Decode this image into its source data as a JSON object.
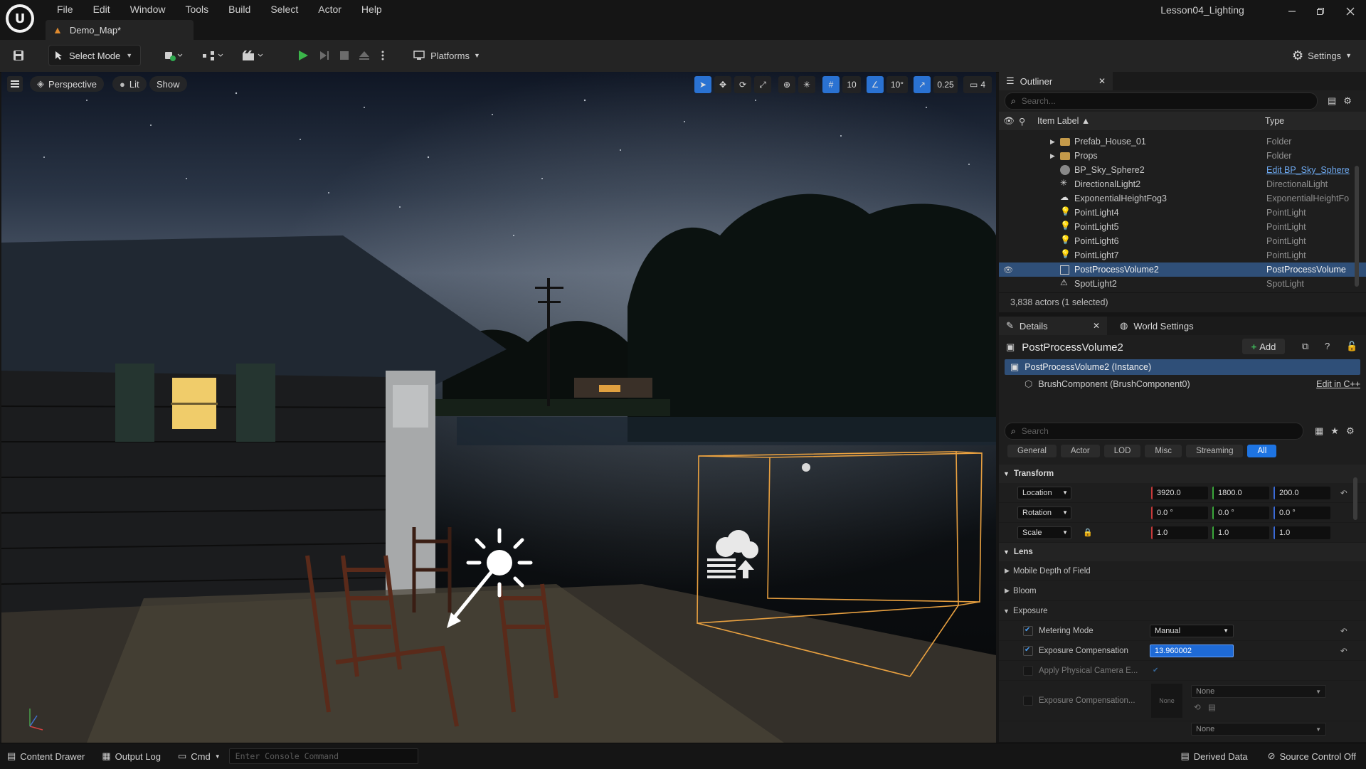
{
  "app": {
    "menu": [
      "File",
      "Edit",
      "Window",
      "Tools",
      "Build",
      "Select",
      "Actor",
      "Help"
    ],
    "map_tab": "Demo_Map*",
    "project_name": "Lesson04_Lighting"
  },
  "toolbar": {
    "select_mode": "Select Mode",
    "platforms": "Platforms",
    "settings": "Settings"
  },
  "viewport": {
    "perspective": "Perspective",
    "lit": "Lit",
    "show": "Show",
    "grid_snap": "10",
    "rotation_snap": "10°",
    "scale_snap": "0.25",
    "camera_speed": "4"
  },
  "outliner": {
    "tab": "Outliner",
    "search_placeholder": "Search...",
    "col_label": "Item Label ▲",
    "col_type": "Type",
    "rows": [
      {
        "name": "Prefab_House_01",
        "type": "Folder"
      },
      {
        "name": "Props",
        "type": "Folder"
      },
      {
        "name": "BP_Sky_Sphere2",
        "type": "Edit BP_Sky_Sphere"
      },
      {
        "name": "DirectionalLight2",
        "type": "DirectionalLight"
      },
      {
        "name": "ExponentialHeightFog3",
        "type": "ExponentialHeightFo"
      },
      {
        "name": "PointLight4",
        "type": "PointLight"
      },
      {
        "name": "PointLight5",
        "type": "PointLight"
      },
      {
        "name": "PointLight6",
        "type": "PointLight"
      },
      {
        "name": "PointLight7",
        "type": "PointLight"
      },
      {
        "name": "PostProcessVolume2",
        "type": "PostProcessVolume"
      },
      {
        "name": "SpotLight2",
        "type": "SpotLight"
      }
    ],
    "footer": "3,838 actors (1 selected)"
  },
  "details": {
    "tab": "Details",
    "tab2": "World Settings",
    "title": "PostProcessVolume2",
    "add": "Add",
    "instance": "PostProcessVolume2 (Instance)",
    "component": "BrushComponent (BrushComponent0)",
    "edit_cpp": "Edit in C++",
    "search_placeholder": "Search",
    "categories": [
      "General",
      "Actor",
      "LOD",
      "Misc",
      "Streaming",
      "All"
    ],
    "transform": {
      "section": "Transform",
      "location_label": "Location",
      "rotation_label": "Rotation",
      "scale_label": "Scale",
      "location": [
        "3920.0",
        "1800.0",
        "200.0"
      ],
      "rotation": [
        "0.0 °",
        "0.0 °",
        "0.0 °"
      ],
      "scale": [
        "1.0",
        "1.0",
        "1.0"
      ]
    },
    "lens": "Lens",
    "mobile_dof": "Mobile Depth of Field",
    "bloom": "Bloom",
    "exposure": "Exposure",
    "metering_mode": "Metering Mode",
    "metering_value": "Manual",
    "exp_comp": "Exposure Compensation",
    "exp_comp_value": "13.960002",
    "apply_phys": "Apply Physical Camera E...",
    "exp_comp_curve": "Exposure Compensation...",
    "none": "None"
  },
  "statusbar": {
    "content_drawer": "Content Drawer",
    "output_log": "Output Log",
    "cmd": "Cmd",
    "console_placeholder": "Enter Console Command",
    "derived_data": "Derived Data",
    "source_control": "Source Control Off"
  }
}
